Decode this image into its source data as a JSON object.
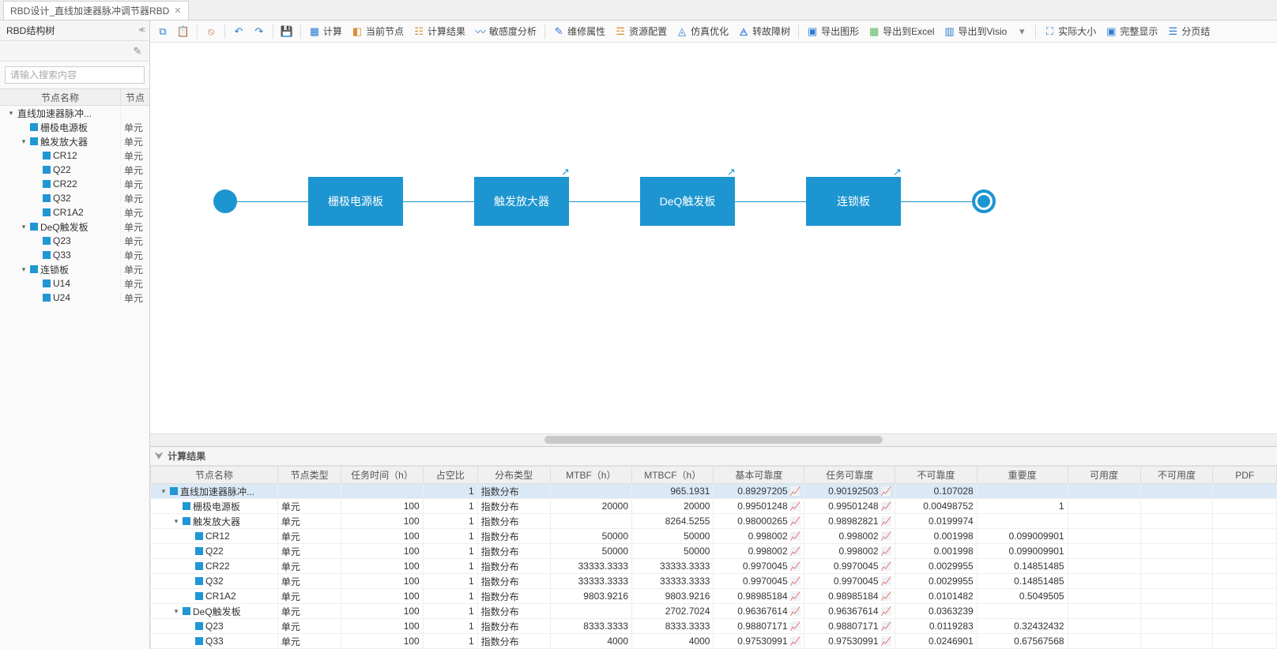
{
  "tab": {
    "title": "RBD设计_直线加速器脉冲调节器RBD"
  },
  "sidebar": {
    "title": "RBD结构树",
    "search_placeholder": "请输入搜索内容",
    "header_name": "节点名称",
    "header_type": "节点",
    "nodes": [
      {
        "name": "直线加速器脉冲...",
        "type": "",
        "level": 0,
        "expandable": true,
        "hasIcon": false
      },
      {
        "name": "栅极电源板",
        "type": "单元",
        "level": 1,
        "expandable": false,
        "hasIcon": true
      },
      {
        "name": "触发放大器",
        "type": "单元",
        "level": 1,
        "expandable": true,
        "hasIcon": true
      },
      {
        "name": "CR12",
        "type": "单元",
        "level": 2,
        "expandable": false,
        "hasIcon": true
      },
      {
        "name": "Q22",
        "type": "单元",
        "level": 2,
        "expandable": false,
        "hasIcon": true
      },
      {
        "name": "CR22",
        "type": "单元",
        "level": 2,
        "expandable": false,
        "hasIcon": true
      },
      {
        "name": "Q32",
        "type": "单元",
        "level": 2,
        "expandable": false,
        "hasIcon": true
      },
      {
        "name": "CR1A2",
        "type": "单元",
        "level": 2,
        "expandable": false,
        "hasIcon": true
      },
      {
        "name": "DeQ触发板",
        "type": "单元",
        "level": 1,
        "expandable": true,
        "hasIcon": true
      },
      {
        "name": "Q23",
        "type": "单元",
        "level": 2,
        "expandable": false,
        "hasIcon": true
      },
      {
        "name": "Q33",
        "type": "单元",
        "level": 2,
        "expandable": false,
        "hasIcon": true
      },
      {
        "name": "连锁板",
        "type": "单元",
        "level": 1,
        "expandable": true,
        "hasIcon": true
      },
      {
        "name": "U14",
        "type": "单元",
        "level": 2,
        "expandable": false,
        "hasIcon": true
      },
      {
        "name": "U24",
        "type": "单元",
        "level": 2,
        "expandable": false,
        "hasIcon": true
      }
    ]
  },
  "toolbar": {
    "calc": "计算",
    "current_node": "当前节点",
    "calc_result": "计算结果",
    "sensitivity": "敏感度分析",
    "maint_attr": "维修属性",
    "resource_cfg": "资源配置",
    "sim_opt": "仿真优化",
    "fault_tree": "转故障树",
    "export_image": "导出图形",
    "export_excel": "导出到Excel",
    "export_visio": "导出到Visio",
    "actual_size": "实际大小",
    "fit_screen": "完整显示",
    "paginate": "分页结"
  },
  "diagram": {
    "blocks": [
      "栅极电源板",
      "触发放大器",
      "DeQ触发板",
      "连锁板"
    ]
  },
  "results": {
    "title": "计算结果",
    "columns": [
      "节点名称",
      "节点类型",
      "任务时间（h）",
      "占空比",
      "分布类型",
      "MTBF（h）",
      "MTBCF（h）",
      "基本可靠度",
      "任务可靠度",
      "不可靠度",
      "重要度",
      "可用度",
      "不可用度",
      "PDF"
    ],
    "rows": [
      {
        "name": "直线加速器脉冲...",
        "type": "",
        "level": 0,
        "exp": true,
        "task": "",
        "duty": "1",
        "dist": "指数分布",
        "mtbf": "",
        "mtbcf": "965.1931",
        "basic": "0.89297205",
        "mission": "0.90192503",
        "unrel": "0.107028",
        "imp": "",
        "avail": "",
        "unavail": "",
        "selected": true,
        "ic1": true,
        "ic2": true
      },
      {
        "name": "栅极电源板",
        "type": "单元",
        "level": 1,
        "exp": false,
        "task": "100",
        "duty": "1",
        "dist": "指数分布",
        "mtbf": "20000",
        "mtbcf": "20000",
        "basic": "0.99501248",
        "mission": "0.99501248",
        "unrel": "0.00498752",
        "imp": "1",
        "ic1": true,
        "ic2": true
      },
      {
        "name": "触发放大器",
        "type": "单元",
        "level": 1,
        "exp": true,
        "task": "100",
        "duty": "1",
        "dist": "指数分布",
        "mtbf": "",
        "mtbcf": "8264.5255",
        "basic": "0.98000265",
        "mission": "0.98982821",
        "unrel": "0.0199974",
        "imp": "",
        "ic1": true,
        "ic2": true
      },
      {
        "name": "CR12",
        "type": "单元",
        "level": 2,
        "exp": false,
        "task": "100",
        "duty": "1",
        "dist": "指数分布",
        "mtbf": "50000",
        "mtbcf": "50000",
        "basic": "0.998002",
        "mission": "0.998002",
        "unrel": "0.001998",
        "imp": "0.099009901",
        "ic1": true,
        "ic2": true
      },
      {
        "name": "Q22",
        "type": "单元",
        "level": 2,
        "exp": false,
        "task": "100",
        "duty": "1",
        "dist": "指数分布",
        "mtbf": "50000",
        "mtbcf": "50000",
        "basic": "0.998002",
        "mission": "0.998002",
        "unrel": "0.001998",
        "imp": "0.099009901",
        "ic1": true,
        "ic2": true
      },
      {
        "name": "CR22",
        "type": "单元",
        "level": 2,
        "exp": false,
        "task": "100",
        "duty": "1",
        "dist": "指数分布",
        "mtbf": "33333.3333",
        "mtbcf": "33333.3333",
        "basic": "0.9970045",
        "mission": "0.9970045",
        "unrel": "0.0029955",
        "imp": "0.14851485",
        "ic1": true,
        "ic2": true
      },
      {
        "name": "Q32",
        "type": "单元",
        "level": 2,
        "exp": false,
        "task": "100",
        "duty": "1",
        "dist": "指数分布",
        "mtbf": "33333.3333",
        "mtbcf": "33333.3333",
        "basic": "0.9970045",
        "mission": "0.9970045",
        "unrel": "0.0029955",
        "imp": "0.14851485",
        "ic1": true,
        "ic2": true
      },
      {
        "name": "CR1A2",
        "type": "单元",
        "level": 2,
        "exp": false,
        "task": "100",
        "duty": "1",
        "dist": "指数分布",
        "mtbf": "9803.9216",
        "mtbcf": "9803.9216",
        "basic": "0.98985184",
        "mission": "0.98985184",
        "unrel": "0.0101482",
        "imp": "0.5049505",
        "ic1": true,
        "ic2": true
      },
      {
        "name": "DeQ触发板",
        "type": "单元",
        "level": 1,
        "exp": true,
        "task": "100",
        "duty": "1",
        "dist": "指数分布",
        "mtbf": "",
        "mtbcf": "2702.7024",
        "basic": "0.96367614",
        "mission": "0.96367614",
        "unrel": "0.0363239",
        "imp": "",
        "ic1": true,
        "ic2": true
      },
      {
        "name": "Q23",
        "type": "单元",
        "level": 2,
        "exp": false,
        "task": "100",
        "duty": "1",
        "dist": "指数分布",
        "mtbf": "8333.3333",
        "mtbcf": "8333.3333",
        "basic": "0.98807171",
        "mission": "0.98807171",
        "unrel": "0.0119283",
        "imp": "0.32432432",
        "ic1": true,
        "ic2": true
      },
      {
        "name": "Q33",
        "type": "单元",
        "level": 2,
        "exp": false,
        "task": "100",
        "duty": "1",
        "dist": "指数分布",
        "mtbf": "4000",
        "mtbcf": "4000",
        "basic": "0.97530991",
        "mission": "0.97530991",
        "unrel": "0.0246901",
        "imp": "0.67567568",
        "ic1": true,
        "ic2": true
      }
    ]
  }
}
